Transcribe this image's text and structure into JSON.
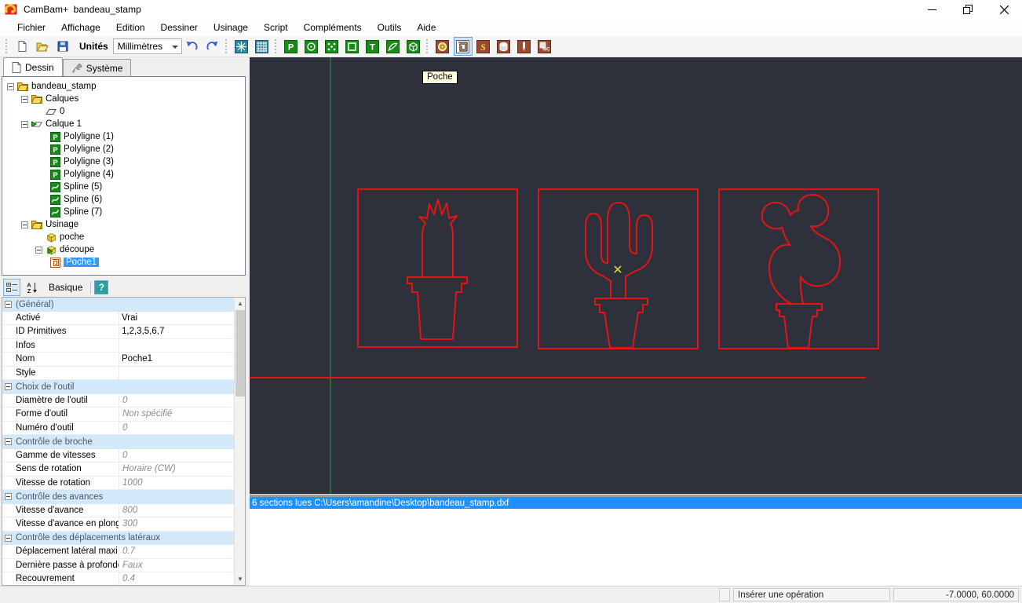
{
  "window": {
    "title": "CamBam+  bandeau_stamp"
  },
  "menu": {
    "items": [
      "Fichier",
      "Affichage",
      "Edition",
      "Dessiner",
      "Usinage",
      "Script",
      "Compléments",
      "Outils",
      "Aide"
    ]
  },
  "toolbar": {
    "units_label": "Unités",
    "units_value": "Millimètres",
    "icon_groups": {
      "file": [
        "new",
        "open",
        "save"
      ],
      "edit": [
        "undo",
        "redo"
      ],
      "view": [
        "toggle-axis",
        "toggle-grid"
      ],
      "draw": [
        "polyline",
        "circle",
        "point-list",
        "rectangle",
        "text",
        "surface",
        "polyhedron"
      ],
      "machining": [
        "drill",
        "pocket",
        "engrave",
        "profile",
        "drill-bit",
        "gcode"
      ]
    },
    "active_tool": "pocket"
  },
  "panel": {
    "tabs": [
      {
        "label": "Dessin"
      },
      {
        "label": "Système"
      }
    ],
    "tree": {
      "items": [
        {
          "label": "bandeau_stamp",
          "icon": "folder"
        },
        {
          "label": "Calques",
          "icon": "folder"
        },
        {
          "label": "0",
          "icon": "layer"
        },
        {
          "label": "Calque 1",
          "icon": "layer-active"
        },
        {
          "label": "Polyligne (1)",
          "icon": "polyline"
        },
        {
          "label": "Polyligne (2)",
          "icon": "polyline"
        },
        {
          "label": "Polyligne (3)",
          "icon": "polyline"
        },
        {
          "label": "Polyligne (4)",
          "icon": "polyline"
        },
        {
          "label": "Spline (5)",
          "icon": "spline"
        },
        {
          "label": "Spline (6)",
          "icon": "spline"
        },
        {
          "label": "Spline (7)",
          "icon": "spline"
        },
        {
          "label": "Usinage",
          "icon": "folder"
        },
        {
          "label": "poche",
          "icon": "mop-cube"
        },
        {
          "label": "découpe",
          "icon": "mop-cube-active"
        },
        {
          "label": "Poche1",
          "icon": "pocket-op",
          "selected": true
        }
      ]
    },
    "properties": {
      "view_label": "Basique",
      "help_label": "?",
      "rows": [
        {
          "type": "section",
          "label": "(Général)"
        },
        {
          "type": "row",
          "label": "Activé",
          "value": "Vrai",
          "inherited": false
        },
        {
          "type": "row",
          "label": "ID Primitives",
          "value": "1,2,3,5,6,7",
          "inherited": false
        },
        {
          "type": "row",
          "label": "Infos",
          "value": "",
          "inherited": false
        },
        {
          "type": "row",
          "label": "Nom",
          "value": "Poche1",
          "inherited": false
        },
        {
          "type": "row",
          "label": "Style",
          "value": "",
          "inherited": false
        },
        {
          "type": "section",
          "label": "Choix de l'outil"
        },
        {
          "type": "row",
          "label": "Diamètre de l'outil",
          "value": "0",
          "inherited": true
        },
        {
          "type": "row",
          "label": "Forme d'outil",
          "value": "Non spécifié",
          "inherited": true
        },
        {
          "type": "row",
          "label": "Numéro d'outil",
          "value": "0",
          "inherited": true
        },
        {
          "type": "section",
          "label": "Contrôle de broche"
        },
        {
          "type": "row",
          "label": "Gamme de vitesses",
          "value": "0",
          "inherited": true
        },
        {
          "type": "row",
          "label": "Sens de rotation",
          "value": "Horaire (CW)",
          "inherited": true
        },
        {
          "type": "row",
          "label": "Vitesse de rotation",
          "value": "1000",
          "inherited": true
        },
        {
          "type": "section",
          "label": "Contrôle des avances"
        },
        {
          "type": "row",
          "label": "Vitesse d'avance",
          "value": "800",
          "inherited": true
        },
        {
          "type": "row",
          "label": "Vitesse d'avance en plong",
          "value": "300",
          "inherited": true
        },
        {
          "type": "section",
          "label": "Contrôle des déplacements latéraux"
        },
        {
          "type": "row",
          "label": "Déplacement latéral maxi",
          "value": "0.7",
          "inherited": true
        },
        {
          "type": "row",
          "label": "Dernière passe à profonde",
          "value": "Faux",
          "inherited": true
        },
        {
          "type": "row",
          "label": "Recouvrement",
          "value": "0.4",
          "inherited": true
        }
      ]
    }
  },
  "canvas": {
    "tooltip": "Poche",
    "colors": {
      "background": "#2e313c",
      "entity": "#e51414",
      "axis_y": "#2a7d2a",
      "marker": "#cfd23c"
    },
    "drawings": [
      "cactus-pineapple-in-pot",
      "cactus-saguaro-in-pot",
      "cactus-prickly-pear-in-pot"
    ]
  },
  "message_bar": {
    "text": "6 sections lues C:\\Users\\amandine\\Desktop\\bandeau_stamp.dxf"
  },
  "status_bar": {
    "hint": "Insérer une opération",
    "coords": "-7.0000, 60.0000"
  }
}
